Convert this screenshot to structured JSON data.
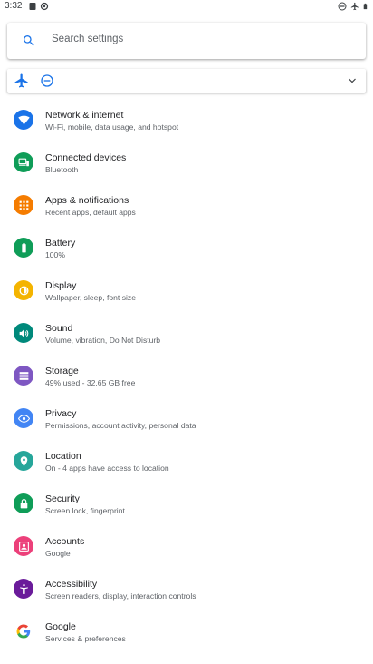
{
  "status_bar": {
    "time": "3:32",
    "left_icons": [
      "media-icon",
      "sync-icon"
    ],
    "right_icons": [
      "dnd-status-icon",
      "airplane-status-icon",
      "battery-icon"
    ]
  },
  "search": {
    "placeholder": "Search settings",
    "icon": "search-icon"
  },
  "conditions": {
    "icons": [
      "airplane-mode-icon",
      "do-not-disturb-icon",
      "expand-icon"
    ]
  },
  "accent_color": "#1a73e8",
  "settings": [
    {
      "id": "network",
      "title": "Network & internet",
      "subtitle": "Wi-Fi, mobile, data usage, and hotspot",
      "icon": "wifi-icon",
      "color": "#1a73e8"
    },
    {
      "id": "connected-devices",
      "title": "Connected devices",
      "subtitle": "Bluetooth",
      "icon": "devices-icon",
      "color": "#0f9d58"
    },
    {
      "id": "apps",
      "title": "Apps & notifications",
      "subtitle": "Recent apps, default apps",
      "icon": "apps-icon",
      "color": "#f57c00"
    },
    {
      "id": "battery",
      "title": "Battery",
      "subtitle": "100%",
      "icon": "battery-icon",
      "color": "#0f9d58"
    },
    {
      "id": "display",
      "title": "Display",
      "subtitle": "Wallpaper, sleep, font size",
      "icon": "brightness-icon",
      "color": "#f4b400"
    },
    {
      "id": "sound",
      "title": "Sound",
      "subtitle": "Volume, vibration, Do Not Disturb",
      "icon": "volume-icon",
      "color": "#00897b"
    },
    {
      "id": "storage",
      "title": "Storage",
      "subtitle": "49% used - 32.65 GB free",
      "icon": "storage-icon",
      "color": "#7e57c2"
    },
    {
      "id": "privacy",
      "title": "Privacy",
      "subtitle": "Permissions, account activity, personal data",
      "icon": "eye-icon",
      "color": "#4285f4"
    },
    {
      "id": "location",
      "title": "Location",
      "subtitle": "On - 4 apps have access to location",
      "icon": "location-icon",
      "color": "#26a69a"
    },
    {
      "id": "security",
      "title": "Security",
      "subtitle": "Screen lock, fingerprint",
      "icon": "lock-icon",
      "color": "#0f9d58"
    },
    {
      "id": "accounts",
      "title": "Accounts",
      "subtitle": "Google",
      "icon": "account-icon",
      "color": "#ec407a"
    },
    {
      "id": "accessibility",
      "title": "Accessibility",
      "subtitle": "Screen readers, display, interaction controls",
      "icon": "accessibility-icon",
      "color": "#6a1b9a"
    },
    {
      "id": "google",
      "title": "Google",
      "subtitle": "Services & preferences",
      "icon": "google-icon",
      "color": "#ffffff"
    }
  ]
}
